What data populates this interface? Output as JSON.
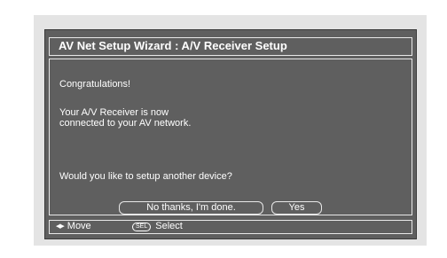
{
  "wizard": {
    "title": "AV Net Setup Wizard : A/V Receiver Setup"
  },
  "content": {
    "congrats": "Congratulations!",
    "connected_line1": "Your A/V Receiver is now",
    "connected_line2": "connected to your AV network.",
    "question": "Would you like to setup another device?"
  },
  "buttons": {
    "no_label": "No thanks, I'm done.",
    "yes_label": "Yes"
  },
  "footer": {
    "move_icon": "left-right-arrows-icon",
    "move_label": "Move",
    "sel_icon_text": "SEL",
    "select_label": "Select"
  },
  "colors": {
    "screen_bg": "#5f5f5f",
    "frame_bg": "#e4e4e4",
    "text": "#ffffff"
  }
}
